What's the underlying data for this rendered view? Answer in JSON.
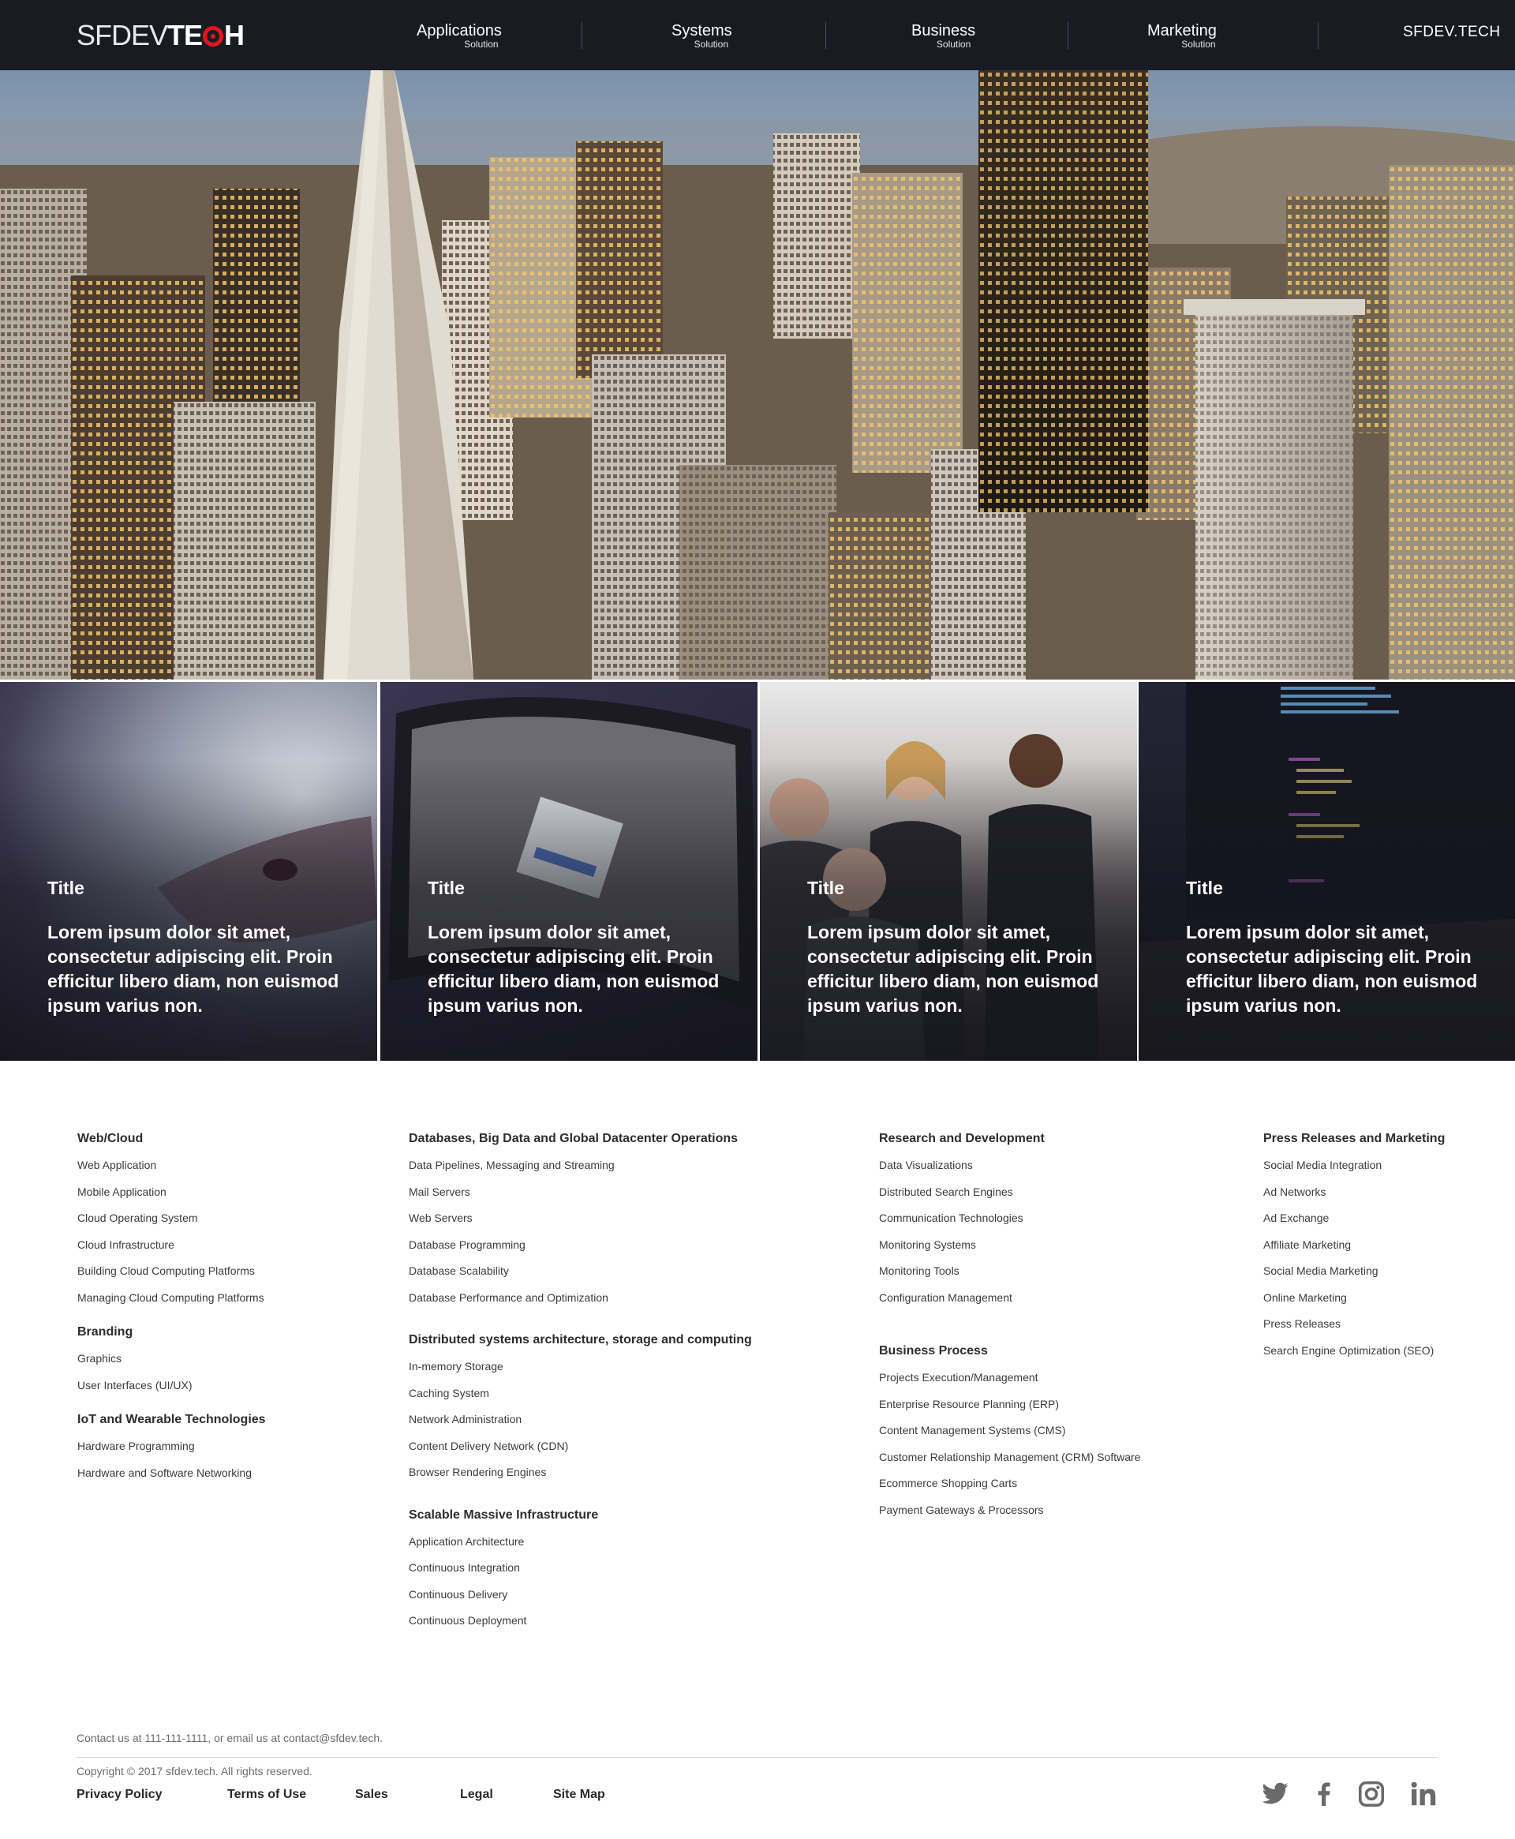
{
  "header": {
    "logo_thin": "SFDEV",
    "logo_bold_pre": "TE",
    "logo_bold_post": "H",
    "nav": [
      {
        "label": "Applications",
        "sub": "Solution"
      },
      {
        "label": "Systems",
        "sub": "Solution"
      },
      {
        "label": "Business",
        "sub": "Solution"
      },
      {
        "label": "Marketing",
        "sub": "Solution"
      }
    ],
    "brand_link": "SFDEV.TECH"
  },
  "cards": [
    {
      "title": "Title",
      "text": "Lorem ipsum dolor sit amet, consectetur adipiscing elit. Proin efficitur libero diam, non euismod ipsum varius non."
    },
    {
      "title": "Title",
      "text": "Lorem ipsum dolor sit amet, consectetur adipiscing elit. Proin efficitur libero diam, non euismod ipsum varius non."
    },
    {
      "title": "Title",
      "text": "Lorem ipsum dolor sit amet, consectetur adipiscing elit. Proin efficitur libero diam, non euismod ipsum varius non."
    },
    {
      "title": "Title",
      "text": "Lorem ipsum dolor sit amet, consectetur adipiscing elit. Proin efficitur libero diam, non euismod ipsum varius non."
    }
  ],
  "footer_columns": [
    {
      "groups": [
        {
          "heading": "Web/Cloud",
          "links": [
            "Web Application",
            "Mobile Application",
            "Cloud Operating System",
            "Cloud Infrastructure",
            "Building Cloud Computing Platforms",
            "Managing  Cloud Computing Platforms"
          ]
        },
        {
          "heading": "Branding",
          "links": [
            "Graphics",
            "User Interfaces (UI/UX)"
          ]
        },
        {
          "heading": "IoT and Wearable Technologies",
          "links": [
            "Hardware Programming",
            "Hardware and Software Networking"
          ]
        }
      ]
    },
    {
      "groups": [
        {
          "heading": "Databases, Big Data and Global Datacenter Operations",
          "links": [
            "Data Pipelines, Messaging and Streaming",
            "Mail Servers",
            "Web Servers",
            "Database Programming",
            "Database Scalability",
            "Database Performance and Optimization"
          ]
        },
        {
          "heading": "Distributed systems architecture, storage and computing",
          "links": [
            "In-memory Storage",
            "Caching System",
            "Network Administration",
            "Content Delivery Network (CDN)",
            "Browser Rendering Engines"
          ]
        },
        {
          "heading": "Scalable Massive Infrastructure",
          "links": [
            "Application Architecture",
            "Continuous Integration",
            "Continuous Delivery",
            "Continuous Deployment"
          ]
        }
      ]
    },
    {
      "groups": [
        {
          "heading": "Research and Development",
          "links": [
            "Data Visualizations",
            "Distributed Search Engines",
            "Communication Technologies",
            "Monitoring Systems",
            "Monitoring Tools",
            "Configuration Management"
          ]
        },
        {
          "heading": "Business Process",
          "links": [
            "Projects Execution/Management",
            "Enterprise Resource Planning (ERP)",
            "Content Management Systems (CMS)",
            "Customer Relationship Management (CRM) Software",
            "Ecommerce Shopping Carts",
            "Payment Gateways & Processors"
          ]
        }
      ]
    },
    {
      "groups": [
        {
          "heading": "Press Releases and Marketing",
          "links": [
            "Social Media Integration",
            "Ad Networks",
            "Ad Exchange",
            "Affiliate Marketing",
            "Social Media Marketing",
            "Online Marketing",
            "Press Releases",
            "Search Engine Optimization (SEO)"
          ]
        }
      ]
    }
  ],
  "footer": {
    "contact": "Contact us at 111-111-1111, or email us at contact@sfdev.tech.",
    "copyright": "Copyright © 2017 sfdev.tech. All rights reserved.",
    "links": [
      "Privacy Policy",
      "Terms of Use",
      "Sales",
      "Legal",
      "Site Map"
    ],
    "social_icons": [
      "twitter-icon",
      "facebook-icon",
      "instagram-icon",
      "linkedin-icon"
    ]
  },
  "colors": {
    "header_bg": "#181b22",
    "accent_red": "#e2161d"
  }
}
